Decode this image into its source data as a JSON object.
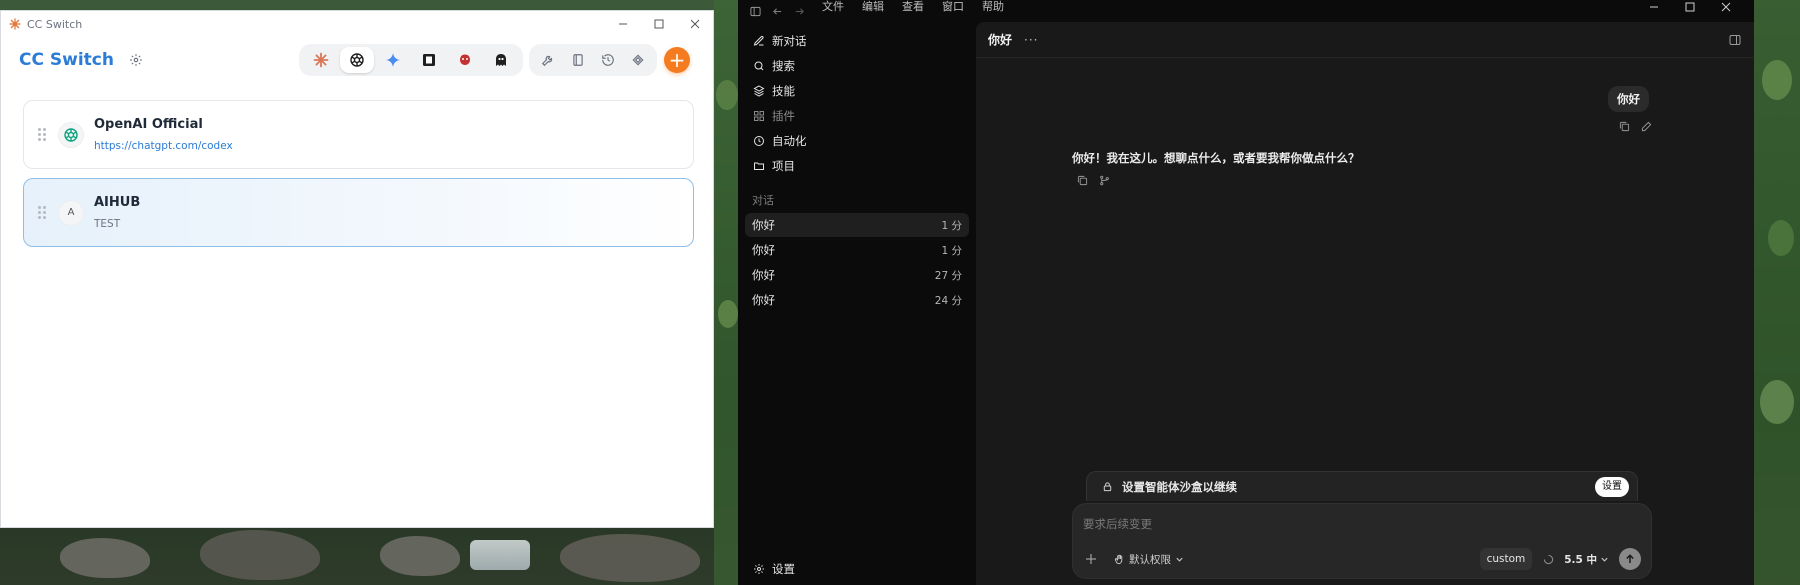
{
  "ccswitch": {
    "window_title": "CC Switch",
    "brand": "CC Switch",
    "toolbar": {
      "apps": [
        {
          "name": "claude-icon",
          "color": "#d97757"
        },
        {
          "name": "openai-icon",
          "color": "#1f1f1f",
          "active": true
        },
        {
          "name": "gemini-icon",
          "color": "#4a8cf0"
        },
        {
          "name": "kilo-icon",
          "color": "#1f1f1f"
        },
        {
          "name": "red-app-icon",
          "color": "#c53030"
        },
        {
          "name": "ghost-icon",
          "color": "#1f1f1f"
        }
      ],
      "tools": [
        "wrench-icon",
        "book-icon",
        "history-icon",
        "mcp-icon"
      ]
    },
    "add_label": "+",
    "providers": [
      {
        "name": "OpenAI Official",
        "subtitle": "https://chatgpt.com/codex",
        "icon": "openai-icon",
        "active": false
      },
      {
        "name": "AIHUB",
        "subtitle": "TEST",
        "icon_letter": "A",
        "active": true
      }
    ],
    "accent_color": "#2a7cd6"
  },
  "codex": {
    "menu": [
      "文件",
      "编辑",
      "查看",
      "窗口",
      "帮助"
    ],
    "nav": [
      {
        "label": "新对话",
        "icon": "new-chat-icon"
      },
      {
        "label": "搜索",
        "icon": "search-icon"
      },
      {
        "label": "技能",
        "icon": "skills-icon"
      },
      {
        "label": "插件",
        "icon": "plugins-icon",
        "dim": true
      },
      {
        "label": "自动化",
        "icon": "clock-icon"
      },
      {
        "label": "项目",
        "icon": "folder-icon"
      }
    ],
    "section_label": "对话",
    "chats": [
      {
        "title": "你好",
        "time": "1 分",
        "active": true
      },
      {
        "title": "你好",
        "time": "1 分"
      },
      {
        "title": "你好",
        "time": "27 分"
      },
      {
        "title": "你好",
        "time": "24 分"
      }
    ],
    "settings_label": "设置",
    "header_title": "你好",
    "header_more": "···",
    "user_message": "你好",
    "assistant_message": "你好！我在这儿。想聊点什么，或者要我帮你做点什么？",
    "sandbox_text": "设置智能体沙盒以继续",
    "sandbox_button": "设置",
    "composer_placeholder": "要求后续变更",
    "permission_label": "默认权限",
    "custom_chip": "custom",
    "model_label": "5.5 中"
  }
}
